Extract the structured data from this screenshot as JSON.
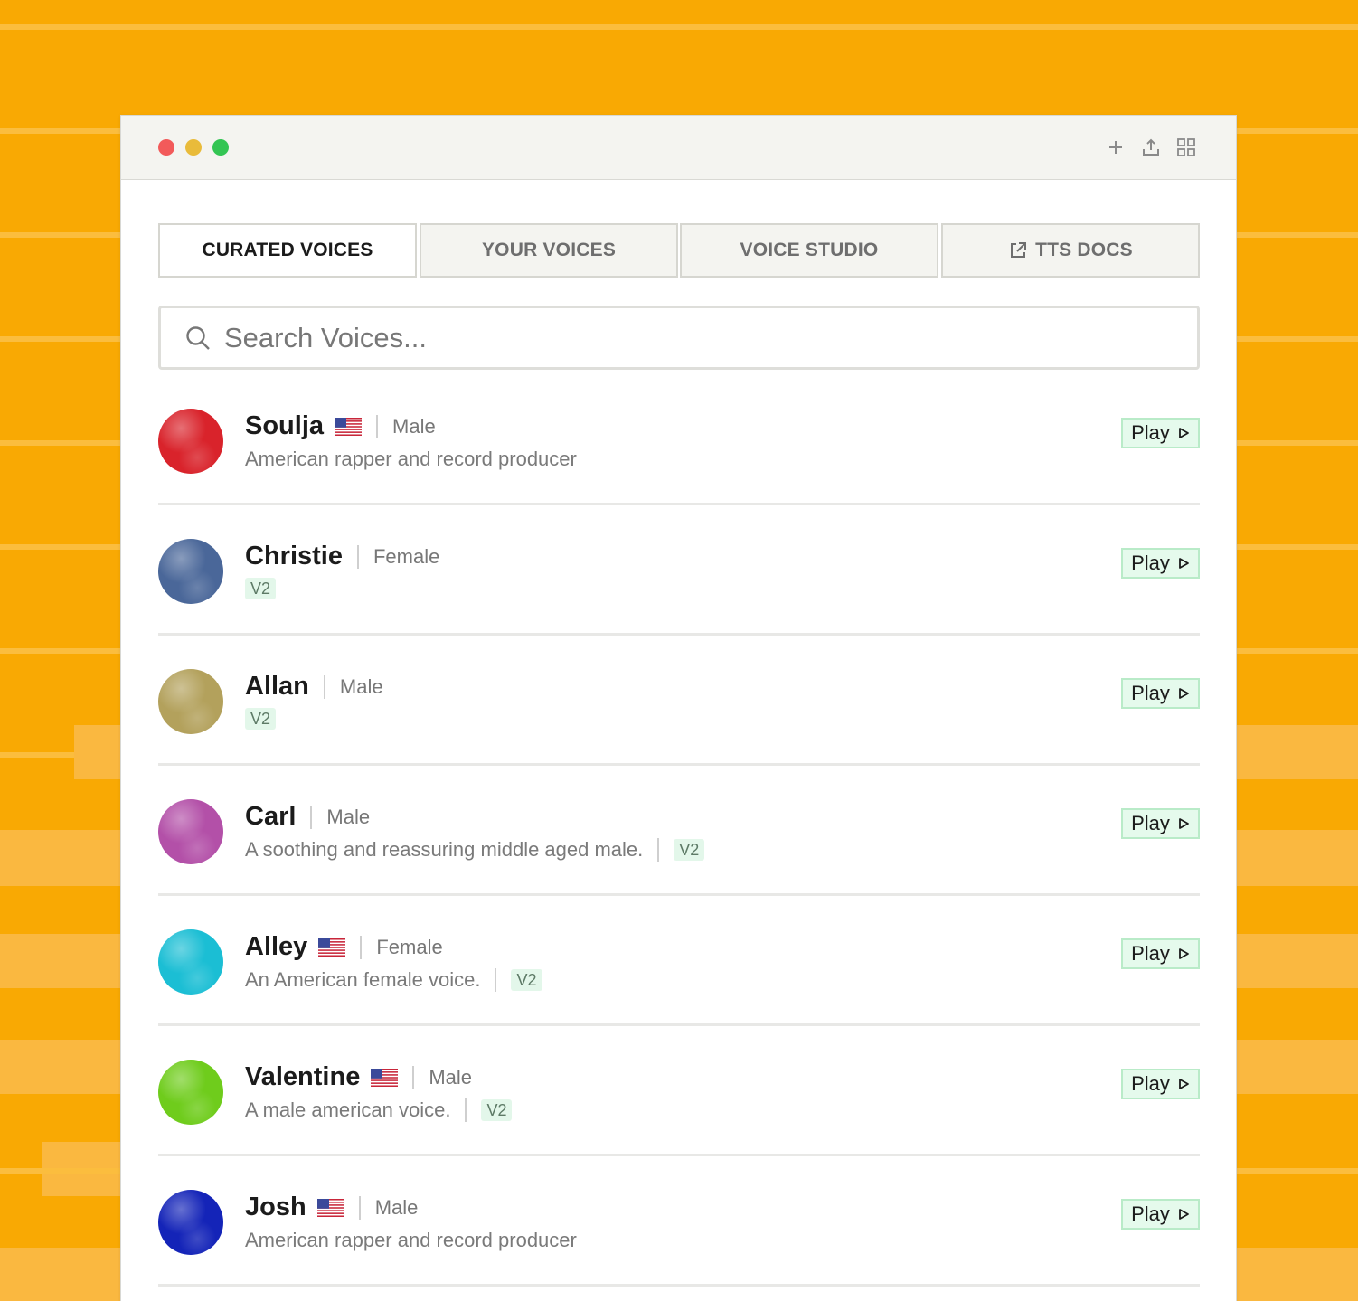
{
  "colors": {
    "background": "#f9a903",
    "play_bg": "#e5faec",
    "badge_bg": "#e3f7ea"
  },
  "window": {
    "controls": [
      "close-dot",
      "minimize-dot",
      "maximize-dot"
    ],
    "toolbar_icons": [
      "plus-icon",
      "share-icon",
      "grid-icon"
    ]
  },
  "tabs": [
    {
      "label": "CURATED VOICES",
      "active": true
    },
    {
      "label": "YOUR VOICES",
      "active": false
    },
    {
      "label": "VOICE STUDIO",
      "active": false
    },
    {
      "label": "TTS DOCS",
      "active": false,
      "icon": "external-link-icon"
    }
  ],
  "search": {
    "placeholder": "Search Voices...",
    "value": "",
    "icon": "search-icon"
  },
  "voices": [
    {
      "name": "Soulja",
      "flag": true,
      "gender": "Male",
      "description": "American rapper and record producer",
      "badge": "",
      "avatar_color": "#d9232b",
      "play_label": "Play"
    },
    {
      "name": "Christie",
      "flag": false,
      "gender": "Female",
      "description": "",
      "badge": "V2",
      "avatar_color": "#4a6799",
      "play_label": "Play"
    },
    {
      "name": "Allan",
      "flag": false,
      "gender": "Male",
      "description": "",
      "badge": "V2",
      "avatar_color": "#b3a15c",
      "play_label": "Play"
    },
    {
      "name": "Carl",
      "flag": false,
      "gender": "Male",
      "description": "A soothing and reassuring middle aged male.",
      "badge": "V2",
      "avatar_color": "#b350a8",
      "play_label": "Play"
    },
    {
      "name": "Alley",
      "flag": true,
      "gender": "Female",
      "description": "An American female voice.",
      "badge": "V2",
      "avatar_color": "#1bbed4",
      "play_label": "Play"
    },
    {
      "name": "Valentine",
      "flag": true,
      "gender": "Male",
      "description": "A male american voice.",
      "badge": "V2",
      "avatar_color": "#6fcc1c",
      "play_label": "Play"
    },
    {
      "name": "Josh",
      "flag": true,
      "gender": "Male",
      "description": "American rapper and record producer",
      "badge": "",
      "avatar_color": "#1424b8",
      "play_label": "Play"
    }
  ]
}
